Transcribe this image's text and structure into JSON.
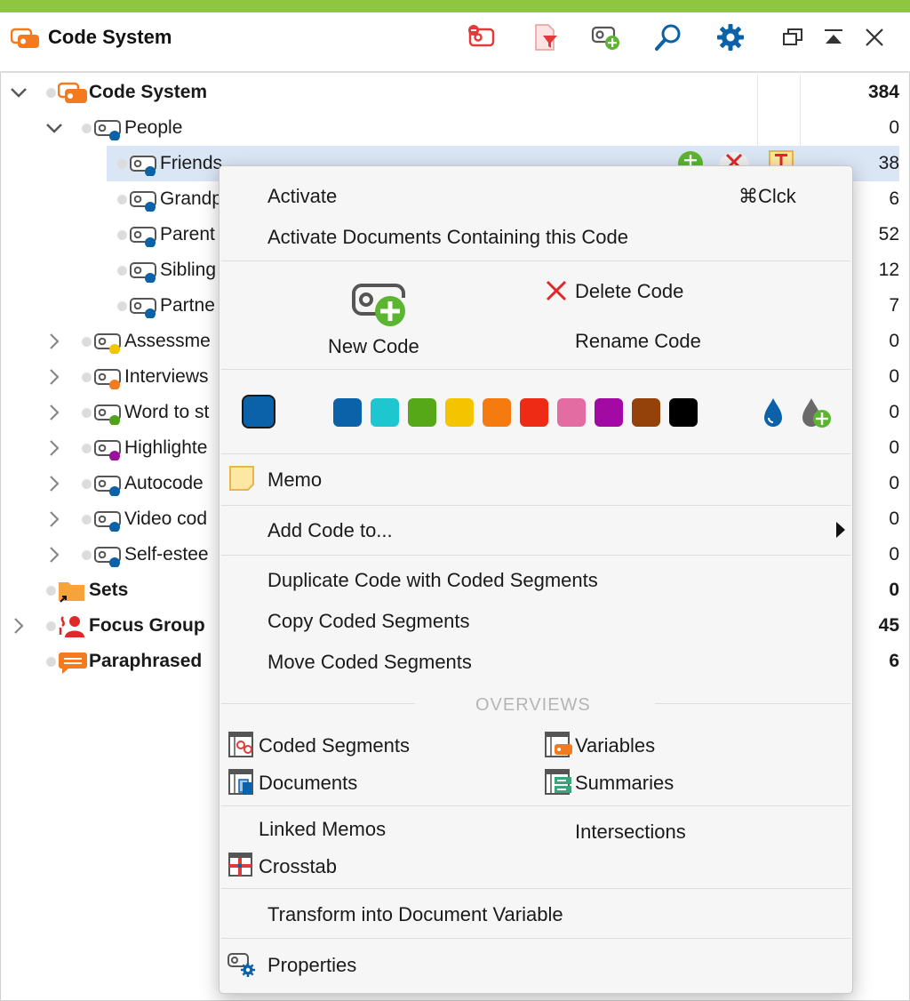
{
  "header": {
    "title": "Code System",
    "tools": [
      {
        "name": "reset-activations-icon"
      },
      {
        "name": "filter-icon"
      },
      {
        "name": "new-code-icon"
      },
      {
        "name": "search-icon"
      },
      {
        "name": "settings-gear-icon"
      },
      {
        "name": "undock-window-icon"
      },
      {
        "name": "collapse-panel-icon"
      },
      {
        "name": "close-icon"
      }
    ]
  },
  "tree": [
    {
      "label": "Code System",
      "count": "384",
      "bold": true
    },
    {
      "label": "People",
      "count": "0"
    },
    {
      "label": "Friends",
      "count": "38"
    },
    {
      "label": "Grandp",
      "count": "6"
    },
    {
      "label": "Parent",
      "count": "52"
    },
    {
      "label": "Sibling",
      "count": "12"
    },
    {
      "label": "Partne",
      "count": "7"
    },
    {
      "label": "Assessme",
      "count": "0"
    },
    {
      "label": "Interviews",
      "count": "0"
    },
    {
      "label": "Word to st",
      "count": "0"
    },
    {
      "label": "Highlighte",
      "count": "0"
    },
    {
      "label": "Autocode",
      "count": "0"
    },
    {
      "label": "Video cod",
      "count": "0"
    },
    {
      "label": "Self-estee",
      "count": "0"
    },
    {
      "label": "Sets",
      "count": "0",
      "bold": true
    },
    {
      "label": "Focus Group",
      "count": "45",
      "bold": true
    },
    {
      "label": "Paraphrased",
      "count": "6",
      "bold": true
    }
  ],
  "colors": {
    "accent_bar": "#8fc63f",
    "selection": "#dbe6f5",
    "dot_blue": "#0b62a8",
    "dot_yellow": "#f5c400",
    "dot_orange": "#f47a1f",
    "dot_green": "#4fa31b",
    "dot_purple": "#9c10a0"
  },
  "menu": {
    "activate": "Activate",
    "activate_shortcut": "⌘Clck",
    "activate_docs": "Activate Documents Containing this Code",
    "new_code": "New Code",
    "delete_code": "Delete Code",
    "rename_code": "Rename Code",
    "swatches": [
      "#0b62a8",
      "#1ec7cf",
      "#56a818",
      "#f5c400",
      "#f57a0f",
      "#ee2c15",
      "#e36da3",
      "#a20aa3",
      "#94420a",
      "#000000"
    ],
    "current_color": "#0b62a8",
    "memo": "Memo",
    "add_code_to": "Add Code to...",
    "duplicate": "Duplicate Code with Coded Segments",
    "copy_segments": "Copy Coded Segments",
    "move_segments": "Move Coded Segments",
    "overviews_title": "OVERVIEWS",
    "coded_segments": "Coded Segments",
    "variables": "Variables",
    "documents": "Documents",
    "summaries": "Summaries",
    "linked_memos": "Linked Memos",
    "intersections": "Intersections",
    "crosstab": "Crosstab",
    "transform": "Transform into Document Variable",
    "properties": "Properties"
  }
}
